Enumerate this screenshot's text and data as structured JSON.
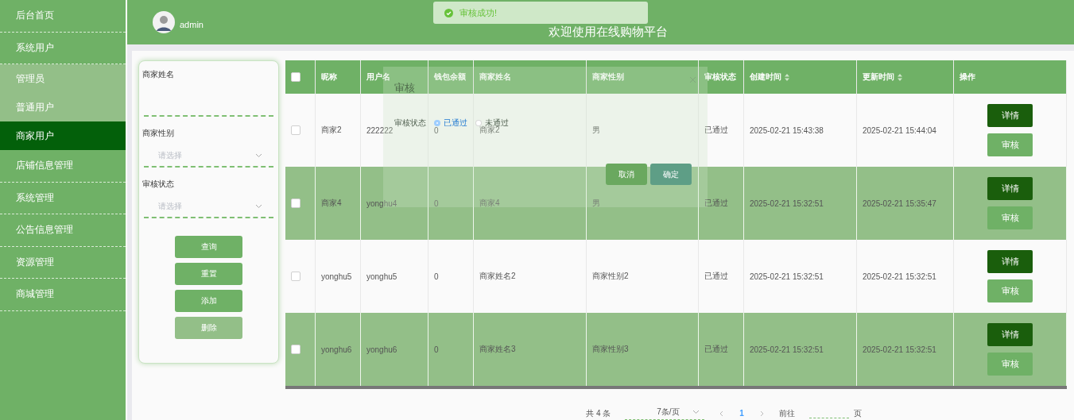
{
  "sidebar": {
    "items": [
      {
        "label": "后台首页",
        "selected": false,
        "kind": "top"
      },
      {
        "label": "系统用户",
        "selected": false,
        "kind": "top"
      },
      {
        "label": "管理员",
        "selected": false,
        "kind": "sub"
      },
      {
        "label": "普通用户",
        "selected": false,
        "kind": "sub"
      },
      {
        "label": "商家用户",
        "selected": true,
        "kind": "sub"
      },
      {
        "label": "店铺信息管理",
        "selected": false,
        "kind": "top"
      },
      {
        "label": "系统管理",
        "selected": false,
        "kind": "top"
      },
      {
        "label": "公告信息管理",
        "selected": false,
        "kind": "top"
      },
      {
        "label": "资源管理",
        "selected": false,
        "kind": "top"
      },
      {
        "label": "商城管理",
        "selected": false,
        "kind": "top"
      }
    ]
  },
  "header": {
    "user": "admin",
    "title": "欢迎使用在线购物平台"
  },
  "toast": {
    "message": "审核成功!"
  },
  "search": {
    "fields": [
      {
        "label": "商家姓名",
        "kind": "input"
      },
      {
        "label": "商家性别",
        "kind": "select",
        "placeholder": "请选择"
      },
      {
        "label": "审核状态",
        "kind": "select",
        "placeholder": "请选择"
      }
    ],
    "buttons": [
      {
        "label": "查询",
        "disabled": false
      },
      {
        "label": "重置",
        "disabled": false
      },
      {
        "label": "添加",
        "disabled": false
      },
      {
        "label": "删除",
        "disabled": true
      }
    ]
  },
  "table": {
    "all_checked": false,
    "columns": [
      {
        "label": "昵称",
        "sortable": false
      },
      {
        "label": "用户名",
        "sortable": false
      },
      {
        "label": "钱包余额",
        "sortable": false
      },
      {
        "label": "商家姓名",
        "sortable": false
      },
      {
        "label": "商家性别",
        "sortable": false
      },
      {
        "label": "审核状态",
        "sortable": false
      },
      {
        "label": "创建时间",
        "sortable": true
      },
      {
        "label": "更新时间",
        "sortable": true
      },
      {
        "label": "操作",
        "sortable": false
      }
    ],
    "rows": [
      {
        "checked": false,
        "cells": [
          "商家2",
          "222222",
          "0",
          "商家2",
          "男",
          "已通过",
          "2025-02-21 15:43:38",
          "2025-02-21 15:44:04"
        ],
        "actions": [
          "详情",
          "审核"
        ]
      },
      {
        "checked": false,
        "cells": [
          "商家4",
          "yonghu4",
          "0",
          "商家4",
          "男",
          "已通过",
          "2025-02-21 15:32:51",
          "2025-02-21 15:35:47"
        ],
        "actions": [
          "详情",
          "审核"
        ]
      },
      {
        "checked": false,
        "cells": [
          "yonghu5",
          "yonghu5",
          "0",
          "商家姓名2",
          "商家性别2",
          "已通过",
          "2025-02-21 15:32:51",
          "2025-02-21 15:32:51"
        ],
        "actions": [
          "详情",
          "审核"
        ]
      },
      {
        "checked": false,
        "cells": [
          "yonghu6",
          "yonghu6",
          "0",
          "商家姓名3",
          "商家性别3",
          "已通过",
          "2025-02-21 15:32:51",
          "2025-02-21 15:32:51"
        ],
        "actions": [
          "详情",
          "审核"
        ]
      }
    ]
  },
  "pagination": {
    "total": "共 4 条",
    "page_size": "7条/页",
    "pages": [
      {
        "label": "1",
        "selected": true
      }
    ],
    "goto": "前往",
    "page_unit": "页"
  },
  "dialog": {
    "title": "审核",
    "field_label": "审核状态",
    "options": [
      {
        "label": "已通过",
        "selected": true
      },
      {
        "label": "未通过",
        "selected": false
      }
    ],
    "buttons": [
      "取消",
      "确定"
    ]
  }
}
